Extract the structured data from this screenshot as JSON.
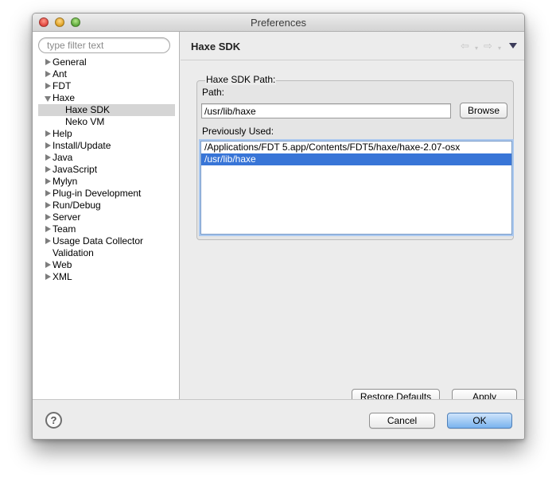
{
  "window": {
    "title": "Preferences"
  },
  "filter": {
    "placeholder": "type filter text"
  },
  "tree": {
    "items": [
      {
        "label": "General",
        "state": "collapsed"
      },
      {
        "label": "Ant",
        "state": "collapsed"
      },
      {
        "label": "FDT",
        "state": "collapsed"
      },
      {
        "label": "Haxe",
        "state": "expanded"
      },
      {
        "label": "Haxe SDK",
        "state": "leaf",
        "selected": true,
        "child": true
      },
      {
        "label": "Neko VM",
        "state": "leaf",
        "child": true
      },
      {
        "label": "Help",
        "state": "collapsed"
      },
      {
        "label": "Install/Update",
        "state": "collapsed"
      },
      {
        "label": "Java",
        "state": "collapsed"
      },
      {
        "label": "JavaScript",
        "state": "collapsed"
      },
      {
        "label": "Mylyn",
        "state": "collapsed"
      },
      {
        "label": "Plug-in Development",
        "state": "collapsed"
      },
      {
        "label": "Run/Debug",
        "state": "collapsed"
      },
      {
        "label": "Server",
        "state": "collapsed"
      },
      {
        "label": "Team",
        "state": "collapsed"
      },
      {
        "label": "Usage Data Collector",
        "state": "collapsed"
      },
      {
        "label": "Validation",
        "state": "leaf"
      },
      {
        "label": "Web",
        "state": "collapsed"
      },
      {
        "label": "XML",
        "state": "collapsed"
      }
    ]
  },
  "page": {
    "title": "Haxe SDK",
    "group_title": "Haxe SDK Path:",
    "path_label": "Path:",
    "path_value": "/usr/lib/haxe",
    "browse_label": "Browse",
    "previous_label": "Previously Used:",
    "previous_items": [
      {
        "text": "/Applications/FDT 5.app/Contents/FDT5/haxe/haxe-2.07-osx",
        "selected": false
      },
      {
        "text": "/usr/lib/haxe",
        "selected": true
      }
    ],
    "restore_label": "Restore Defaults",
    "apply_label": "Apply"
  },
  "nav": {
    "back_icon": "⇦",
    "forward_icon": "⇨",
    "dropdown_icon": "▾"
  },
  "footer": {
    "help_symbol": "?",
    "cancel_label": "Cancel",
    "ok_label": "OK"
  },
  "colors": {
    "selection": "#3875d7",
    "tree_selection": "#d5d5d5",
    "default_button": "#7ab3ee"
  }
}
